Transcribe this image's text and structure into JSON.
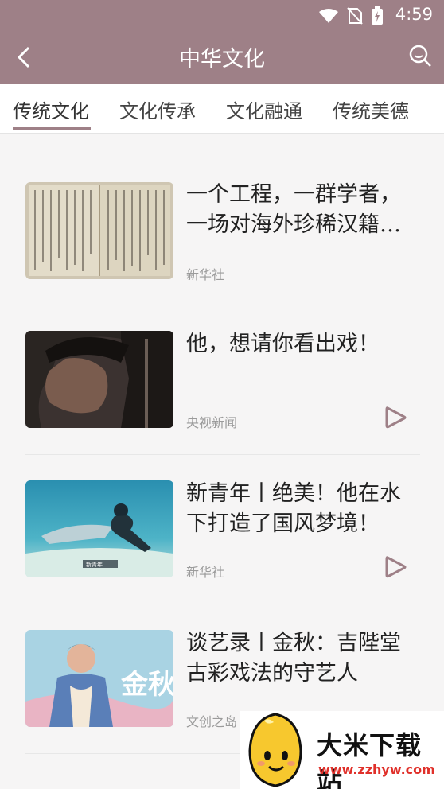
{
  "status_bar": {
    "time": "4:59"
  },
  "header": {
    "title": "中华文化"
  },
  "tabs": [
    {
      "label": "传统文化",
      "active": true
    },
    {
      "label": "文化传承",
      "active": false
    },
    {
      "label": "文化融通",
      "active": false
    },
    {
      "label": "传统美德",
      "active": false
    }
  ],
  "articles": [
    {
      "title": "一个工程，一群学者，一场对海外珍稀汉籍…",
      "source": "新华社",
      "video": false
    },
    {
      "title": "他，想请你看出戏！",
      "source": "央视新闻",
      "video": true
    },
    {
      "title": "新青年丨绝美！他在水下打造了国风梦境！",
      "source": "新华社",
      "video": true
    },
    {
      "title": "谈艺录丨金秋：吉陛堂古彩戏法的守艺人",
      "source": "文创之岛",
      "video": false
    }
  ],
  "thumb_texts": {
    "news_tag": "新青年",
    "name_art": "金秋"
  },
  "watermark": {
    "name": "大米下载站",
    "url": "www.zzhyw.com"
  },
  "colors": {
    "header": "#9e8087",
    "accent": "#9e8087",
    "source_text": "#9b9b9b"
  },
  "icons": {
    "back": "chevron-left-icon",
    "search": "search-icon",
    "play": "play-icon"
  }
}
